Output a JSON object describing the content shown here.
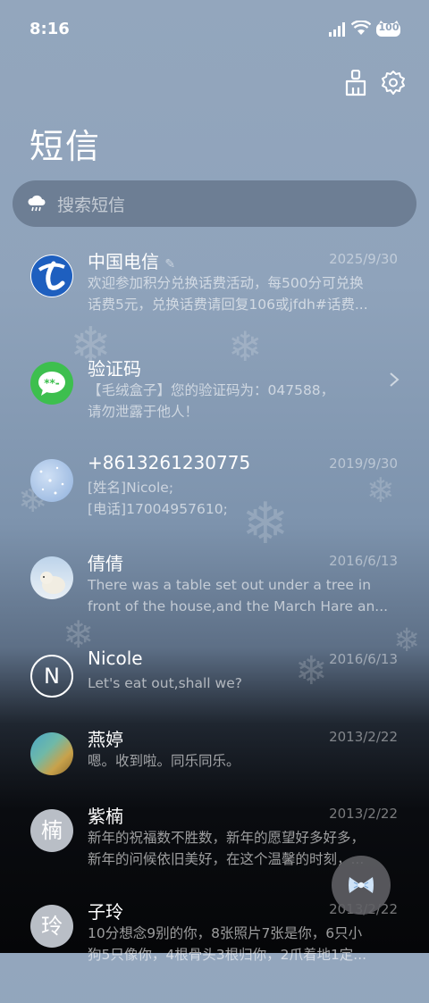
{
  "status_bar": {
    "time": "8:16",
    "battery": "100"
  },
  "header": {
    "title": "短信"
  },
  "search": {
    "placeholder": "搜索短信"
  },
  "messages": [
    {
      "name": "中国电信",
      "date": "2025/9/30",
      "preview": [
        "欢迎参加积分兑换话费活动，每500分可兑换",
        "话费5元，兑换话费请回复106或jfdh#话费..."
      ],
      "avatar": "china-telecom-logo"
    },
    {
      "name": "验证码",
      "date": "",
      "preview": [
        "【毛绒盒子】您的验证码为：047588，",
        "请勿泄露于他人！"
      ],
      "avatar": "sms-bubble-icon"
    },
    {
      "name": "+8613261230775",
      "date": "2019/9/30",
      "preview": [
        "[姓名]Nicole;",
        "[电话]17004957610;"
      ],
      "avatar": "snow-photo"
    },
    {
      "name": "倩倩",
      "date": "2016/6/13",
      "preview": [
        "There was a table set out under a tree in",
        "front of the house,and the March Hare an..."
      ],
      "avatar": "polar-bear-photo"
    },
    {
      "name": "Nicole",
      "date": "2016/6/13",
      "preview": [
        "Let's eat out,shall we?"
      ],
      "avatar_letter": "N"
    },
    {
      "name": "燕婷",
      "date": "2013/2/22",
      "preview": [
        "嗯。收到啦。同乐同乐。"
      ],
      "avatar": "landscape-photo"
    },
    {
      "name": "紫楠",
      "date": "2013/2/22",
      "preview": [
        "新年的祝福数不胜数，新年的愿望好多好多，",
        "新年的问候依旧美好，在这个温馨的时刻，..."
      ],
      "avatar_letter": "楠"
    },
    {
      "name": "子玲",
      "date": "2013/2/22",
      "preview": [
        "10分想念9别的你，8张照片7张是你，6只小",
        "狗5只像你，4根骨头3根归你，2爪着地1定..."
      ],
      "avatar_letter": "玲"
    }
  ]
}
